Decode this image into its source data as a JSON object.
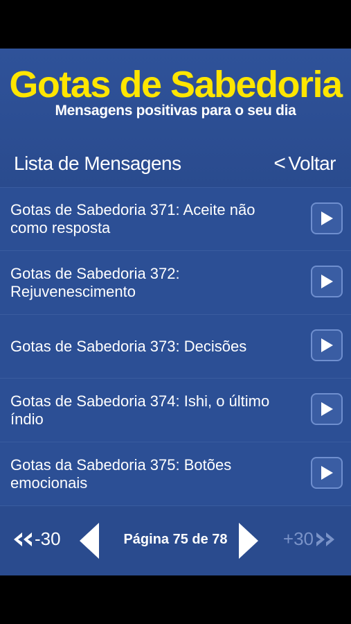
{
  "header": {
    "title": "Gotas de Sabedoria",
    "subtitle": "Mensagens positivas para o seu dia"
  },
  "nav": {
    "section_title": "Lista de Mensagens",
    "back_chevron": "<",
    "back_label": "Voltar"
  },
  "messages": [
    {
      "label": "Gotas de Sabedoria 371: Aceite não como resposta"
    },
    {
      "label": "Gotas de Sabedoria 372: Rejuvenescimento"
    },
    {
      "label": "Gotas de Sabedoria 373: Decisões"
    },
    {
      "label": "Gotas de Sabedoria 374: Ishi, o último índio"
    },
    {
      "label": "Gotas da Sabedoria 375: Botões emocionais"
    }
  ],
  "pager": {
    "back_jump": "-30",
    "page_label": "Página 75 de 78",
    "forward_jump": "+30"
  },
  "colors": {
    "background": "#2c4f95",
    "title": "#ffe600",
    "text": "#ffffff",
    "disabled": "#7a93c8"
  }
}
